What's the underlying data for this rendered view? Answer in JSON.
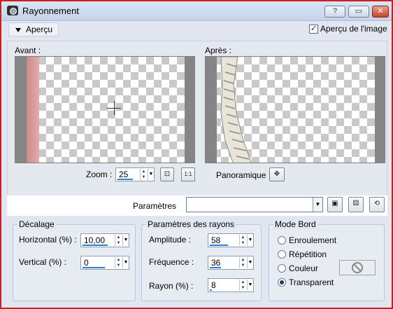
{
  "window": {
    "title": "Rayonnement",
    "buttons": {
      "help": "?",
      "minimize": "▭",
      "close": "✕"
    }
  },
  "preview_toggle": {
    "label": "Aperçu"
  },
  "image_preview": {
    "label": "Aperçu de l'image",
    "checked": true
  },
  "before": {
    "label": "Avant :"
  },
  "after": {
    "label": "Après :"
  },
  "zoom": {
    "label": "Zoom :",
    "value": "25"
  },
  "panoramique": {
    "label": "Panoramique :"
  },
  "parametres": {
    "label": "Paramètres",
    "value": ""
  },
  "decalage": {
    "title": "Décalage",
    "horizontal_label": "Horizontal (%) :",
    "horizontal_value": "10,00",
    "vertical_label": "Vertical (%) :",
    "vertical_value": "0"
  },
  "rayons": {
    "title": "Paramètres des rayons",
    "amplitude_label": "Amplitude :",
    "amplitude_value": "58",
    "frequence_label": "Fréquence :",
    "frequence_value": "36",
    "rayon_label": "Rayon (%) :",
    "rayon_value": "8"
  },
  "mode_bord": {
    "title": "Mode Bord",
    "options": [
      "Enroulement",
      "Répétition",
      "Couleur",
      "Transparent"
    ],
    "selected": "Transparent"
  },
  "watermark": "..............."
}
